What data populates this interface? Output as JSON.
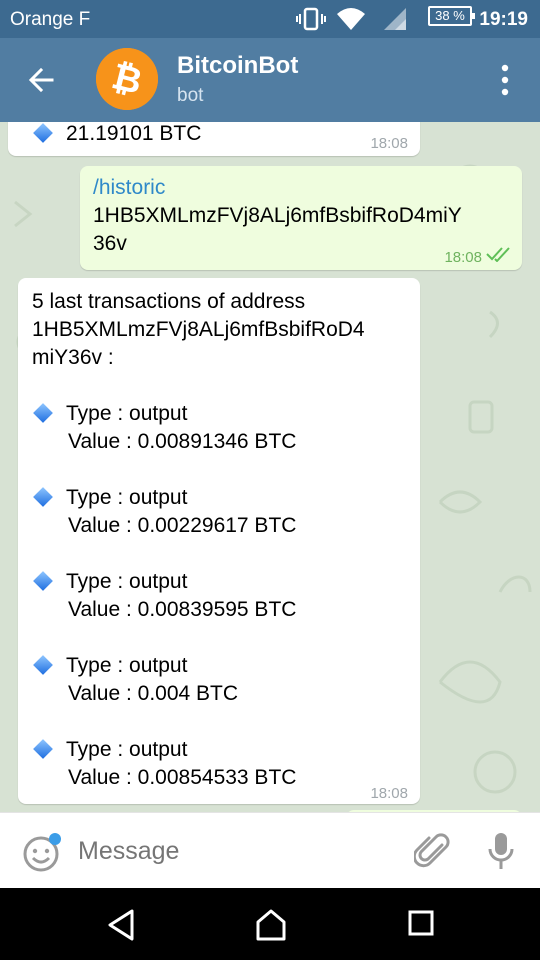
{
  "status_bar": {
    "carrier": "Orange F",
    "battery": "38 %",
    "time": "19:19"
  },
  "header": {
    "title": "BitcoinBot",
    "subtitle": "bot",
    "avatar_symbol": "₿"
  },
  "messages": [
    {
      "type": "in",
      "text": "21.19101 BTC",
      "time": "18:08"
    },
    {
      "type": "out",
      "command": "/historic",
      "text_line1": "1HB5XMLmzFVj8ALj6mfBsbifRoD4miY",
      "text_line2": "36v",
      "time": "18:08"
    },
    {
      "type": "in",
      "intro_line1": "5 last transactions of address",
      "intro_line2": "1HB5XMLmzFVj8ALj6mfBsbifRoD4",
      "intro_line3": "miY36v :",
      "transactions": [
        {
          "type": "Type : output",
          "value": "Value : 0.00891346 BTC"
        },
        {
          "type": "Type : output",
          "value": "Value : 0.00229617 BTC"
        },
        {
          "type": "Type : output",
          "value": "Value : 0.00839595 BTC"
        },
        {
          "type": "Type : output",
          "value": "Value : 0.004 BTC"
        },
        {
          "type": "Type : output",
          "value": "Value : 0.00854533 BTC"
        }
      ],
      "time": "18:08"
    }
  ],
  "input": {
    "placeholder": "Message"
  },
  "colors": {
    "header": "#517da2",
    "status_bar": "#3d6a90",
    "chat_bg": "#d7e2d3",
    "out_bubble": "#effdde",
    "bitcoin": "#f7931a",
    "link": "#2f89c9"
  }
}
